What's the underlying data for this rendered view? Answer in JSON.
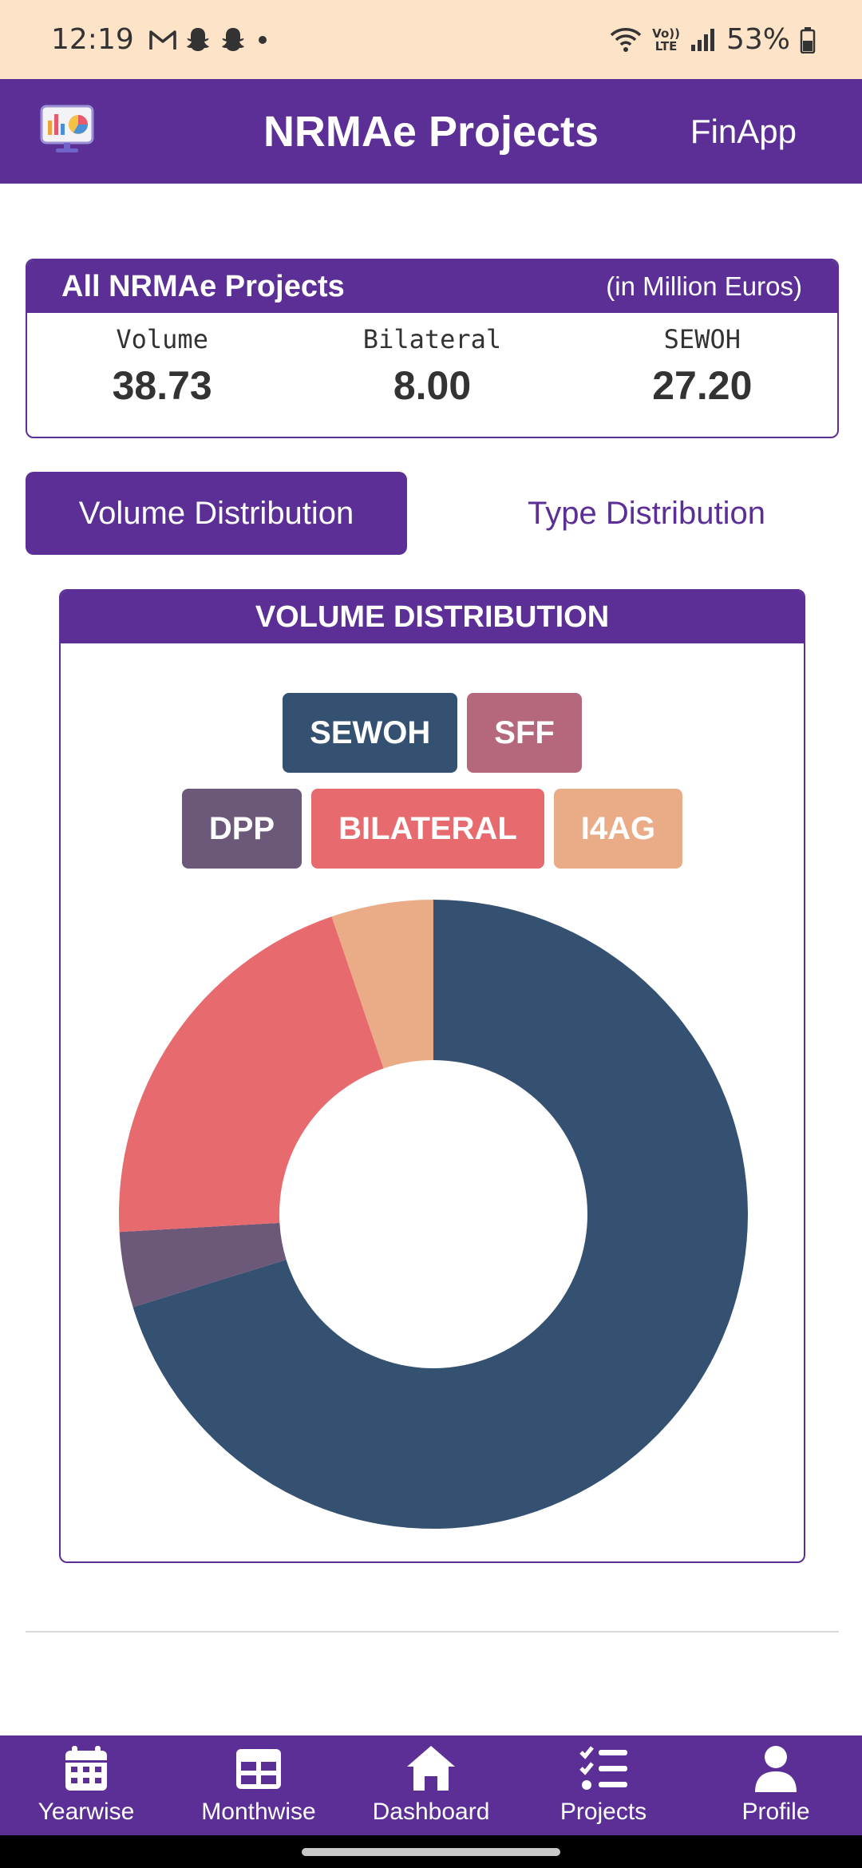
{
  "status_bar": {
    "time": "12:19",
    "lte_top": "Vo))",
    "lte_bottom": "LTE",
    "battery": "53%"
  },
  "app_bar": {
    "title": "NRMAe Projects",
    "action": "FinApp",
    "logo_icon": "presentation-chart-icon"
  },
  "summary": {
    "title": "All NRMAe Projects",
    "unit": "(in Million Euros)",
    "metrics": [
      {
        "label": "Volume",
        "value": "38.73"
      },
      {
        "label": "Bilateral",
        "value": "8.00"
      },
      {
        "label": "SEWOH",
        "value": "27.20"
      }
    ]
  },
  "tabs": {
    "active": "Volume Distribution",
    "inactive": "Type Distribution"
  },
  "chart_card": {
    "title": "VOLUME DISTRIBUTION"
  },
  "chart_data": {
    "type": "pie",
    "title": "VOLUME DISTRIBUTION",
    "donut": true,
    "categories": [
      "SEWOH",
      "SFF",
      "DPP",
      "BILATERAL",
      "I4AG"
    ],
    "values": [
      27.2,
      0,
      1.5,
      8.0,
      2.03
    ],
    "colors": [
      "#355172",
      "#b5677b",
      "#6c5878",
      "#e76a6e",
      "#eaab87"
    ],
    "legend": "top"
  },
  "bottom_nav": {
    "items": [
      {
        "label": "Yearwise",
        "icon": "calendar-icon"
      },
      {
        "label": "Monthwise",
        "icon": "table-grid-icon"
      },
      {
        "label": "Dashboard",
        "icon": "home-icon"
      },
      {
        "label": "Projects",
        "icon": "checklist-icon"
      },
      {
        "label": "Profile",
        "icon": "user-icon"
      }
    ]
  }
}
